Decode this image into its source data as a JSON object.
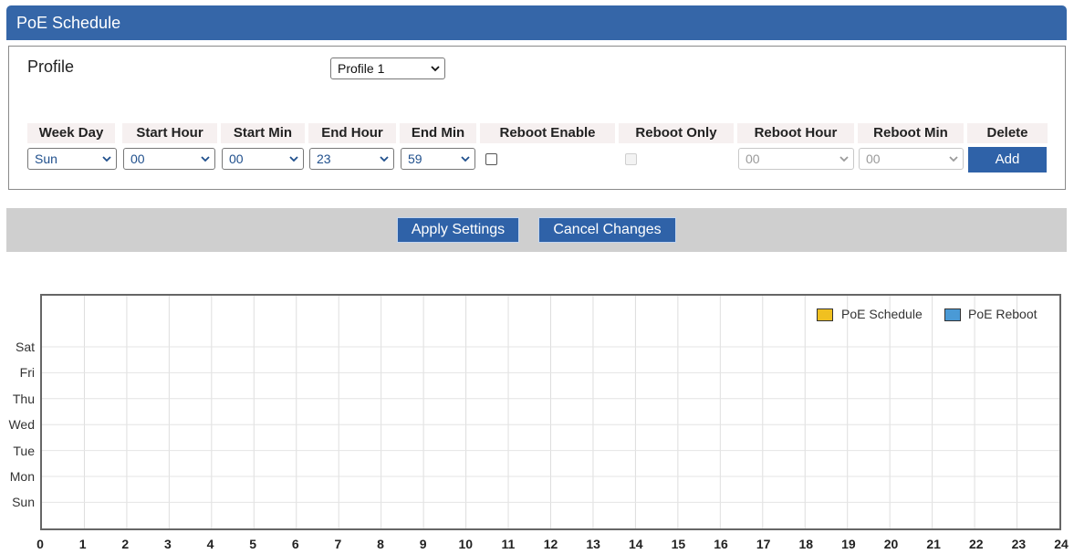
{
  "panel": {
    "title": "PoE Schedule"
  },
  "profile": {
    "label": "Profile",
    "selected": "Profile 1"
  },
  "table": {
    "headers": [
      "Week Day",
      "Start Hour",
      "Start Min",
      "End Hour",
      "End Min",
      "Reboot Enable",
      "Reboot Only",
      "Reboot Hour",
      "Reboot Min",
      "Delete"
    ],
    "row": {
      "week_day": "Sun",
      "start_hour": "00",
      "start_min": "00",
      "end_hour": "23",
      "end_min": "59",
      "reboot_enable": false,
      "reboot_only": false,
      "reboot_hour": "00",
      "reboot_min": "00",
      "add_label": "Add"
    }
  },
  "actions": {
    "apply_label": "Apply Settings",
    "cancel_label": "Cancel Changes"
  },
  "chart_data": {
    "type": "timeline",
    "y_categories": [
      "Sat",
      "Fri",
      "Thu",
      "Wed",
      "Tue",
      "Mon",
      "Sun"
    ],
    "x_ticks": [
      "0",
      "1",
      "2",
      "3",
      "4",
      "5",
      "6",
      "7",
      "8",
      "9",
      "10",
      "11",
      "12",
      "13",
      "14",
      "15",
      "16",
      "17",
      "18",
      "19",
      "20",
      "21",
      "22",
      "23",
      "24"
    ],
    "xlim": [
      0,
      24
    ],
    "grid": true,
    "legend": [
      {
        "name": "PoE Schedule",
        "color": "#f0c020"
      },
      {
        "name": "PoE Reboot",
        "color": "#4a9ad6"
      }
    ],
    "legend_position": "top-right",
    "series": [
      {
        "name": "PoE Schedule",
        "values": []
      },
      {
        "name": "PoE Reboot",
        "values": []
      }
    ]
  },
  "colors": {
    "header": "#3566a8",
    "button": "#2f62a8",
    "bar": "#cfcfcf"
  }
}
